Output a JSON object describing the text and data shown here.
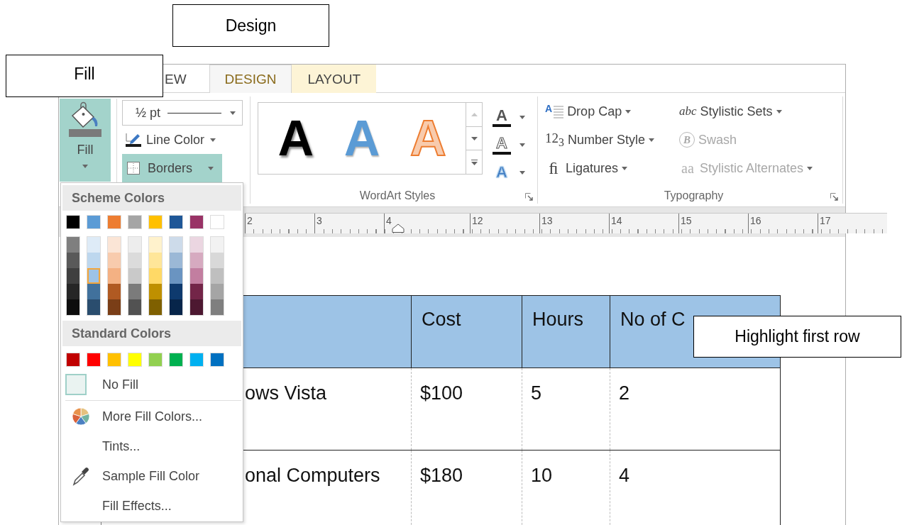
{
  "callouts": [
    {
      "text": "Design"
    },
    {
      "text": "Fill"
    },
    {
      "text": "Highlight first row"
    }
  ],
  "tabs": [
    {
      "label": "EW",
      "selected": false,
      "contextual": false
    },
    {
      "label": "DESIGN",
      "selected": true,
      "contextual": true
    },
    {
      "label": "LAYOUT",
      "selected": false,
      "contextual": true
    }
  ],
  "ribbon": {
    "fill_button": {
      "label": "Fill",
      "open": true
    },
    "line_weight": {
      "value": "½ pt"
    },
    "line_color": {
      "label": "Line Color"
    },
    "borders": {
      "label": "Borders",
      "highlighted": true
    },
    "wordart": {
      "label": "WordArt Styles",
      "styles": [
        {
          "glyph": "A",
          "kind": "shadow"
        },
        {
          "glyph": "A",
          "kind": "fill"
        },
        {
          "glyph": "A",
          "kind": "outline"
        }
      ],
      "tools": [
        {
          "glyph": "A",
          "kind": "fill"
        },
        {
          "glyph": "A",
          "kind": "outline"
        },
        {
          "glyph": "A",
          "kind": "effects"
        }
      ]
    },
    "typography": {
      "label": "Typography",
      "items": [
        {
          "label": "Drop Cap",
          "glyph": "A",
          "kind": "dropcap",
          "dropdown": true,
          "disabled": false
        },
        {
          "label": "Stylistic Sets",
          "glyph": "abc",
          "kind": "sets",
          "dropdown": true,
          "disabled": false
        },
        {
          "label": "Number Style",
          "glyph": "12$_{3}$",
          "kind": "number",
          "dropdown": true,
          "disabled": false
        },
        {
          "label": "Swash",
          "glyph": "B",
          "kind": "swash",
          "dropdown": false,
          "disabled": true
        },
        {
          "label": "Ligatures",
          "glyph": "ﬁ",
          "kind": "ligature",
          "dropdown": true,
          "disabled": false
        },
        {
          "label": "Stylistic Alternates",
          "glyph": "aa",
          "kind": "alternates",
          "dropdown": true,
          "disabled": true
        }
      ]
    }
  },
  "ruler": {
    "labels": [
      {
        "text": "2",
        "kind": "tick"
      },
      {
        "text": "3",
        "kind": "tick"
      },
      {
        "text": "4",
        "kind": "indent"
      },
      {
        "text": "12",
        "kind": "tick"
      },
      {
        "text": "13",
        "kind": "tick"
      },
      {
        "text": "14",
        "kind": "tick"
      },
      {
        "text": "15",
        "kind": "tick"
      },
      {
        "text": "16",
        "kind": "tick"
      },
      {
        "text": "17",
        "kind": "tick"
      }
    ]
  },
  "table": {
    "header": [
      "Cost",
      "Hours",
      "No of C"
    ],
    "rows": [
      [
        "ows Vista",
        "$100",
        "5",
        "2"
      ],
      [
        "onal Computers",
        "$180",
        "10",
        "4"
      ]
    ]
  },
  "fill_menu": {
    "scheme_header": "Scheme Colors",
    "scheme_colors": [
      {
        "color": "#000000",
        "selected": false,
        "tints": [
          {
            "color": "#7f7f7f",
            "selected": false
          },
          {
            "color": "#595959",
            "selected": false
          },
          {
            "color": "#3f3f3f",
            "selected": false
          },
          {
            "color": "#262626",
            "selected": false
          },
          {
            "color": "#0d0d0d",
            "selected": false
          }
        ]
      },
      {
        "color": "#5b9bd5",
        "selected": false,
        "tints": [
          {
            "color": "#deebf7",
            "selected": false
          },
          {
            "color": "#bdd7ee",
            "selected": false
          },
          {
            "color": "#9dc3e6",
            "selected": true
          },
          {
            "color": "#41719c",
            "selected": false
          },
          {
            "color": "#2a4d6e",
            "selected": false
          }
        ]
      },
      {
        "color": "#ed7d31",
        "selected": false,
        "tints": [
          {
            "color": "#fbe5d6",
            "selected": false
          },
          {
            "color": "#f8cbad",
            "selected": false
          },
          {
            "color": "#f4b183",
            "selected": false
          },
          {
            "color": "#b05a22",
            "selected": false
          },
          {
            "color": "#7a3e17",
            "selected": false
          }
        ]
      },
      {
        "color": "#a5a5a5",
        "selected": false,
        "tints": [
          {
            "color": "#ededed",
            "selected": false
          },
          {
            "color": "#dbdbdb",
            "selected": false
          },
          {
            "color": "#c9c9c9",
            "selected": false
          },
          {
            "color": "#7b7b7b",
            "selected": false
          },
          {
            "color": "#525252",
            "selected": false
          }
        ]
      },
      {
        "color": "#ffc000",
        "selected": false,
        "tints": [
          {
            "color": "#fff2cc",
            "selected": false
          },
          {
            "color": "#ffe699",
            "selected": false
          },
          {
            "color": "#ffd966",
            "selected": false
          },
          {
            "color": "#bf9000",
            "selected": false
          },
          {
            "color": "#7f6000",
            "selected": false
          }
        ]
      },
      {
        "color": "#1f5797",
        "selected": false,
        "tints": [
          {
            "color": "#cddbea",
            "selected": false
          },
          {
            "color": "#9bb8d6",
            "selected": false
          },
          {
            "color": "#6a94c1",
            "selected": false
          },
          {
            "color": "#0e3a6e",
            "selected": false
          },
          {
            "color": "#07254a",
            "selected": false
          }
        ]
      },
      {
        "color": "#993366",
        "selected": false,
        "tints": [
          {
            "color": "#ebd6e1",
            "selected": false
          },
          {
            "color": "#d6aac0",
            "selected": false
          },
          {
            "color": "#c27ea0",
            "selected": false
          },
          {
            "color": "#732548",
            "selected": false
          },
          {
            "color": "#4d1831",
            "selected": false
          }
        ]
      },
      {
        "color": "#ffffff",
        "selected": false,
        "tints": [
          {
            "color": "#f2f2f2",
            "selected": false
          },
          {
            "color": "#d8d8d8",
            "selected": false
          },
          {
            "color": "#bfbfbf",
            "selected": false
          },
          {
            "color": "#a5a5a5",
            "selected": false
          },
          {
            "color": "#7f7f7f",
            "selected": false
          }
        ]
      }
    ],
    "standard_header": "Standard Colors",
    "standard_colors": [
      {
        "color": "#c00000",
        "selected": false
      },
      {
        "color": "#ff0000",
        "selected": false
      },
      {
        "color": "#ffc000",
        "selected": false
      },
      {
        "color": "#ffff00",
        "selected": false
      },
      {
        "color": "#92d050",
        "selected": false
      },
      {
        "color": "#00b050",
        "selected": false
      },
      {
        "color": "#00b0f0",
        "selected": false
      },
      {
        "color": "#0070c0",
        "selected": false
      }
    ],
    "no_fill": {
      "label": "No Fill"
    },
    "commands": [
      {
        "label": "More Fill Colors...",
        "kind": "palette"
      },
      {
        "label": "Tints...",
        "kind": "plain"
      },
      {
        "label": "Sample Fill Color",
        "kind": "eyedropper"
      },
      {
        "label": "Fill Effects...",
        "kind": "plain"
      }
    ]
  }
}
